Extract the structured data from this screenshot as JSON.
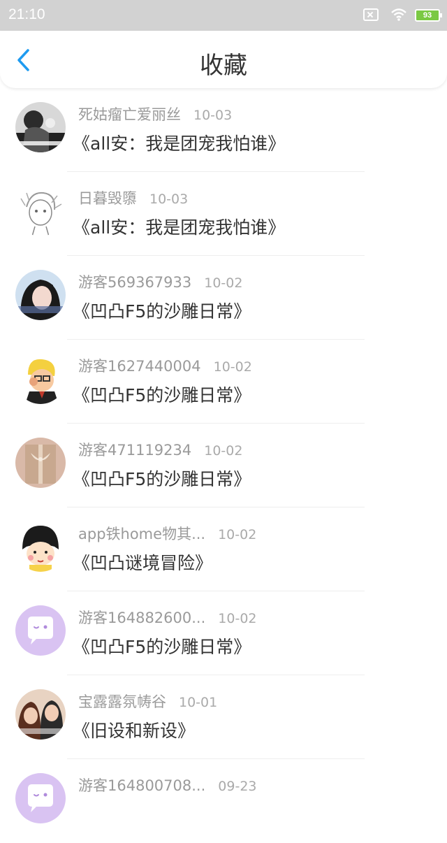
{
  "status": {
    "time": "21:10",
    "battery": "93"
  },
  "header": {
    "title": "收藏"
  },
  "items": [
    {
      "name": "死姑瘤亡爱丽丝",
      "date": "10-03",
      "title": "《all安：我是团宠我怕谁》",
      "avatar": "bw-photo-avatar"
    },
    {
      "name": "日暮毁隳",
      "date": "10-03",
      "title": "《all安：我是团宠我怕谁》",
      "avatar": "sketch-avatar"
    },
    {
      "name": "游客569367933",
      "date": "10-02",
      "title": "《凹凸F5的沙雕日常》",
      "avatar": "girl-photo-avatar"
    },
    {
      "name": "游客1627440004",
      "date": "10-02",
      "title": "《凹凸F5的沙雕日常》",
      "avatar": "cartoon-blond-avatar"
    },
    {
      "name": "游客471119234",
      "date": "10-02",
      "title": "《凹凸F5的沙雕日常》",
      "avatar": "ribbon-photo-avatar"
    },
    {
      "name": "app铁home物其...",
      "date": "10-02",
      "title": "《凹凸谜境冒险》",
      "avatar": "maruko-avatar"
    },
    {
      "name": "游客164882600...",
      "date": "10-02",
      "title": "《凹凸F5的沙雕日常》",
      "avatar": "default-chat-avatar"
    },
    {
      "name": "宝露露氛帱谷",
      "date": "10-01",
      "title": "《旧设和新设》",
      "avatar": "couple-photo-avatar"
    },
    {
      "name": "游客164800708...",
      "date": "09-23",
      "title": "",
      "avatar": "default-chat-avatar"
    }
  ]
}
